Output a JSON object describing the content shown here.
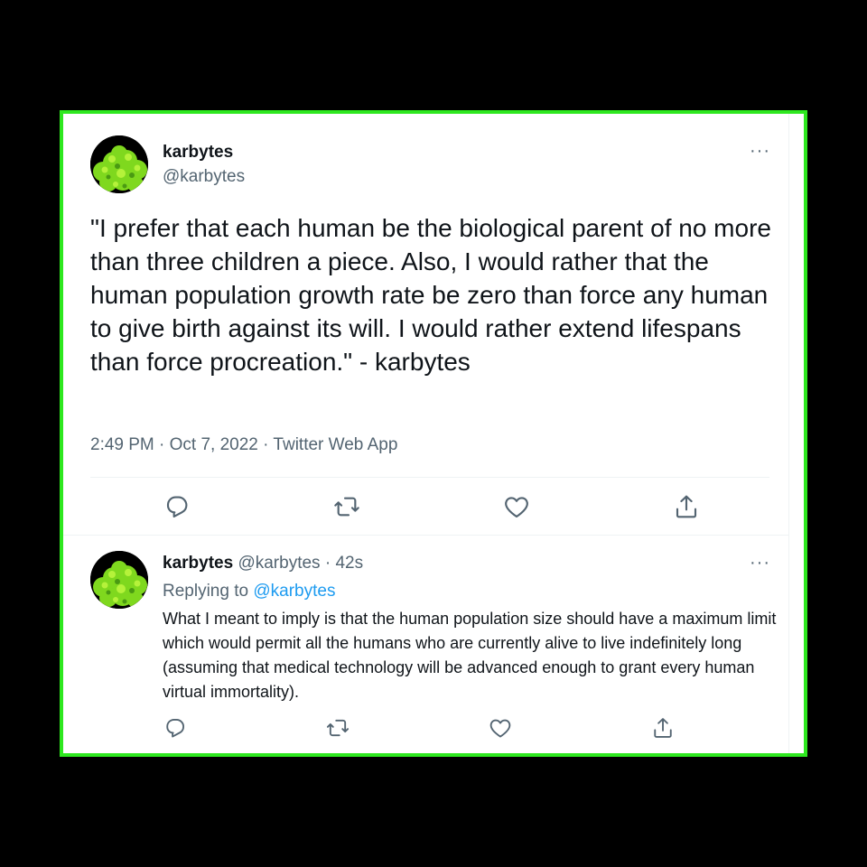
{
  "main_tweet": {
    "display_name": "karbytes",
    "handle": "@karbytes",
    "more_label": "···",
    "text": "\"I prefer that each human be the biological parent of no more than three children a piece. Also, I would rather that the human population growth rate be zero than force any human to give birth against its will. I would rather extend lifespans than force procreation.\" - karbytes",
    "timestamp": "2:49 PM · Oct 7, 2022 · Twitter Web App"
  },
  "reply_tweet": {
    "display_name": "karbytes",
    "handle": "@karbytes",
    "separator": "·",
    "time": "42s",
    "more_label": "···",
    "replying_label": "Replying to",
    "replying_handle": "@karbytes",
    "text": "What I meant to imply is that the human population size should have a maximum limit which would permit all the humans who are currently alive to live indefinitely long (assuming that medical technology will be advanced enough to grant every human virtual immortality)."
  },
  "actions": [
    "reply-icon",
    "retweet-icon",
    "like-icon",
    "share-icon"
  ],
  "colors": {
    "frame_border": "#2ee81f",
    "background": "#000000",
    "text_primary": "#0f1419",
    "text_secondary": "#536471",
    "link": "#1d9bf0",
    "avatar_foliage": "#7fd81e"
  }
}
